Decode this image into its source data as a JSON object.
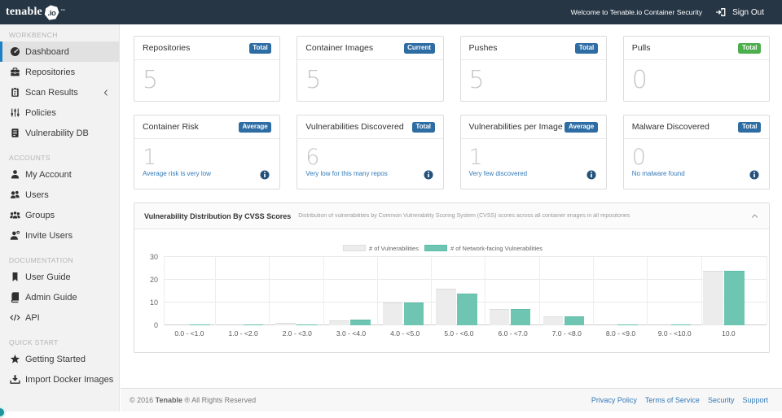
{
  "colors": {
    "topbar_bg": "#273645",
    "sidebar_bg": "#f2f2f2",
    "active_accent": "#1d80c3",
    "badge_blue": "#2e6da4",
    "badge_green": "#4cae4c",
    "link_blue": "#337ab7",
    "bar_gray": "#ececec",
    "bar_teal": "#6dc5b2"
  },
  "topbar": {
    "logo_text": "tenable",
    "logo_io": ".io",
    "logo_tm": "™",
    "welcome": "Welcome to Tenable.io Container Security",
    "sign_out": "Sign Out"
  },
  "sidebar": {
    "sections": [
      {
        "label": "WORKBENCH",
        "items": [
          {
            "icon": "dashboard-icon",
            "label": "Dashboard",
            "active": true
          },
          {
            "icon": "repositories-icon",
            "label": "Repositories"
          },
          {
            "icon": "scan-results-icon",
            "label": "Scan Results",
            "chevron": true
          },
          {
            "icon": "policies-icon",
            "label": "Policies"
          },
          {
            "icon": "vulnerability-db-icon",
            "label": "Vulnerability DB"
          }
        ]
      },
      {
        "label": "ACCOUNTS",
        "items": [
          {
            "icon": "my-account-icon",
            "label": "My Account"
          },
          {
            "icon": "users-icon",
            "label": "Users"
          },
          {
            "icon": "groups-icon",
            "label": "Groups"
          },
          {
            "icon": "invite-users-icon",
            "label": "Invite Users"
          }
        ]
      },
      {
        "label": "DOCUMENTATION",
        "items": [
          {
            "icon": "user-guide-icon",
            "label": "User Guide"
          },
          {
            "icon": "admin-guide-icon",
            "label": "Admin Guide"
          },
          {
            "icon": "api-icon",
            "label": "API"
          }
        ]
      },
      {
        "label": "QUICK START",
        "items": [
          {
            "icon": "getting-started-icon",
            "label": "Getting Started"
          },
          {
            "icon": "import-docker-icon",
            "label": "Import Docker Images"
          }
        ]
      }
    ]
  },
  "stats_row1": [
    {
      "title": "Repositories",
      "badge": "Total",
      "badge_color": "#2e6da4",
      "value": "5"
    },
    {
      "title": "Container Images",
      "badge": "Current",
      "badge_color": "#2e6da4",
      "value": "5"
    },
    {
      "title": "Pushes",
      "badge": "Total",
      "badge_color": "#2e6da4",
      "value": "5"
    },
    {
      "title": "Pulls",
      "badge": "Total",
      "badge_color": "#4cae4c",
      "value": "0"
    }
  ],
  "stats_row2": [
    {
      "title": "Container Risk",
      "badge": "Average",
      "badge_color": "#2e6da4",
      "value": "1",
      "note": "Average risk is very low"
    },
    {
      "title": "Vulnerabilities Discovered",
      "badge": "Total",
      "badge_color": "#2e6da4",
      "value": "6",
      "note": "Very low for this many repos"
    },
    {
      "title": "Vulnerabilities per Image",
      "badge": "Average",
      "badge_color": "#2e6da4",
      "value": "1",
      "note": "Very few discovered"
    },
    {
      "title": "Malware Discovered",
      "badge": "Total",
      "badge_color": "#2e6da4",
      "value": "0",
      "note": "No malware found"
    }
  ],
  "chart_panel": {
    "title": "Vulnerability Distribution By CVSS Scores",
    "subtitle": "Distribution of vulnerabilities by Common Vulnerability Scoring System (CVSS) scores across all container images in all repositories"
  },
  "chart_data": {
    "type": "bar",
    "categories": [
      "0.0 - <1.0",
      "1.0 - <2.0",
      "2.0 - <3.0",
      "3.0 - <4.0",
      "4.0 - <5.0",
      "5.0 - <6.0",
      "6.0 - <7.0",
      "7.0 - <8.0",
      "8.0 - <9.0",
      "9.0 - <10.0",
      "10.0"
    ],
    "series": [
      {
        "name": "# of Vulnerabilities",
        "color": "#ececec",
        "border": "#dddddd",
        "values": [
          0,
          0,
          1,
          2.2,
          10,
          16,
          7,
          4,
          0,
          0,
          24
        ]
      },
      {
        "name": "# of Network-facing Vulnerabilities",
        "color": "#6dc5b2",
        "border": "#5fbcaa",
        "values": [
          0.3,
          0.3,
          0.3,
          2.4,
          10,
          14,
          7,
          4,
          0.3,
          0.3,
          24
        ]
      }
    ],
    "ylim": [
      0,
      30
    ],
    "yticks": [
      0,
      10,
      20,
      30
    ],
    "legend_position": "top center",
    "grid": true
  },
  "footer": {
    "copyright_prefix": "© 2016 ",
    "brand": "Tenable",
    "copyright_suffix": " ® All Rights Reserved",
    "links": [
      "Privacy Policy",
      "Terms of Service",
      "Security",
      "Support"
    ]
  }
}
